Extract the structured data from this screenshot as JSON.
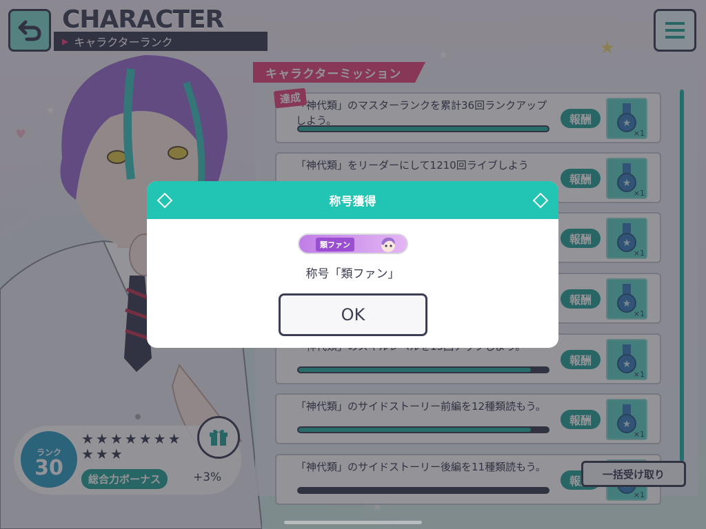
{
  "header": {
    "title": "CHARACTER",
    "subtitle": "キャラクターランク",
    "back_icon": "back-arrow-icon",
    "menu_icon": "hamburger-menu-icon"
  },
  "missions": {
    "panel_title": "キャラクターミッション",
    "done_badge": "達成",
    "reward_label": "報酬",
    "reward_qty": "×1",
    "items": [
      {
        "text": "「神代類」のマスターランクを累計36回ランクアップしよう。",
        "progress": 1.0
      },
      {
        "text": "「神代類」をリーダーにして1210回ライブしよう",
        "progress": 0.0
      },
      {
        "text": "",
        "progress": 0.0
      },
      {
        "text": "",
        "progress": 0.0
      },
      {
        "text": "「神代類」のスキルレベルを15回アップしよう。",
        "progress": 0.93
      },
      {
        "text": "「神代類」のサイドストーリー前編を12種類読もう。",
        "progress": 0.93
      },
      {
        "text": "「神代類」のサイドストーリー後編を11種類読もう。",
        "progress": 0.0
      }
    ],
    "claim_all_label": "一括受け取り"
  },
  "dialog": {
    "title": "称号獲得",
    "plate_label": "類ファン",
    "message": "称号「類ファン」",
    "ok_label": "OK"
  },
  "rank": {
    "label": "ランク",
    "value": "30",
    "stars": "★★★★★★★★★★",
    "bonus_label": "総合力ボーナス",
    "bonus_value": "+3%"
  },
  "colors": {
    "accent_teal": "#22c4b3",
    "accent_pink": "#e8487b",
    "dark": "#3b3d52"
  }
}
